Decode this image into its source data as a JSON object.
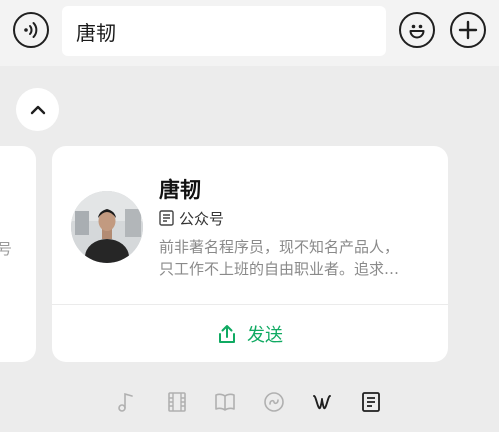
{
  "search": {
    "query": "唐韧"
  },
  "card": {
    "name": "唐韧",
    "type_label": "公众号",
    "desc_line1": "前非著名程序员，现不知名产品人，",
    "desc_line2": "只工作不上班的自由职业者。追求…",
    "send_label": "发送"
  },
  "prev_card": {
    "fragment": "号"
  },
  "colors": {
    "accent": "#10aa62",
    "background": "#ececec"
  },
  "icons": {
    "voice": "voice-icon",
    "emoji": "emoji-icon",
    "add": "add-icon",
    "collapse": "chevron-up-icon",
    "article": "article-icon",
    "share": "share-icon",
    "tabs": [
      "music-icon",
      "video-icon",
      "book-icon",
      "miniprogram-icon",
      "channels-icon",
      "article-icon"
    ]
  },
  "tabbar": {
    "selected_index": 5
  }
}
